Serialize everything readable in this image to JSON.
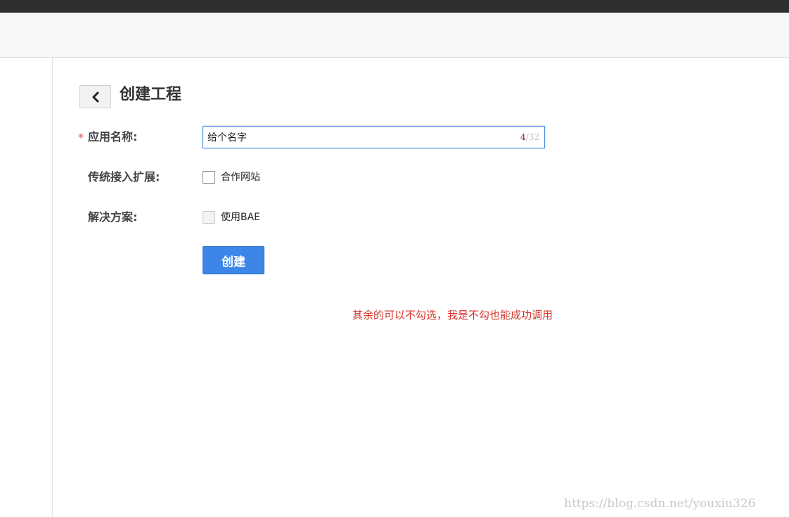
{
  "header": {
    "title": ""
  },
  "page": {
    "title": "创建工程",
    "back_icon": "chevron-left-icon"
  },
  "form": {
    "required_mark": "*",
    "app_name": {
      "label": "应用名称:",
      "value": "给个名字",
      "counter_current": "4",
      "counter_sep_max": "/32"
    },
    "legacy_extension": {
      "label": "传统接入扩展:",
      "option_label": "合作网站",
      "checked": false
    },
    "solution": {
      "label": "解决方案:",
      "option_label": "使用BAE",
      "checked": false
    },
    "submit_label": "创建"
  },
  "annotation": "其余的可以不勾选，我是不勾也能成功调用",
  "watermark": "https://blog.csdn.net/youxiu326",
  "colors": {
    "primary_button": "#3d86e8",
    "annotation_text": "#d9342b",
    "required_star": "#d9534f",
    "topbar": "#2f2f2f"
  }
}
